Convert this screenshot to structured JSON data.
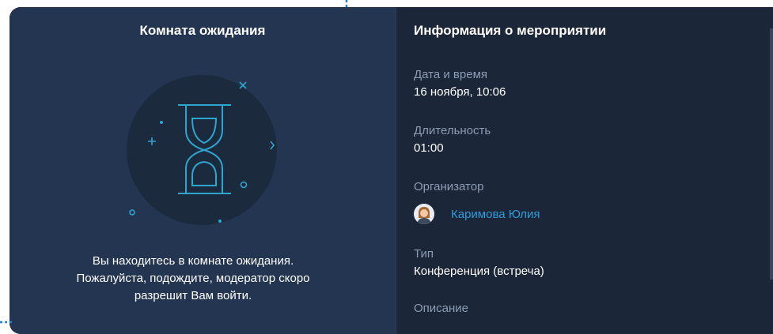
{
  "waiting_room": {
    "title": "Комната ожидания",
    "message_line1": "Вы находитесь в комнате ожидания.",
    "message_line2": "Пожалуйста, подождите, модератор скоро",
    "message_line3": "разрешит Вам войти."
  },
  "event_info": {
    "title": "Информация о мероприятии",
    "date_label": "Дата и время",
    "date_value": "16 ноября, 10:06",
    "duration_label": "Длительность",
    "duration_value": "01:00",
    "organizer_label": "Организатор",
    "organizer_name": "Каримова Юлия",
    "type_label": "Тип",
    "type_value": "Конференция (встреча)",
    "description_label": "Описание"
  },
  "colors": {
    "left_panel": "#233550",
    "right_panel": "#1b2638",
    "accent": "#2d9cdb",
    "illustration_line": "#2fa6cf"
  },
  "icons": {
    "hourglass": "hourglass-icon",
    "avatar": "organizer-avatar"
  }
}
